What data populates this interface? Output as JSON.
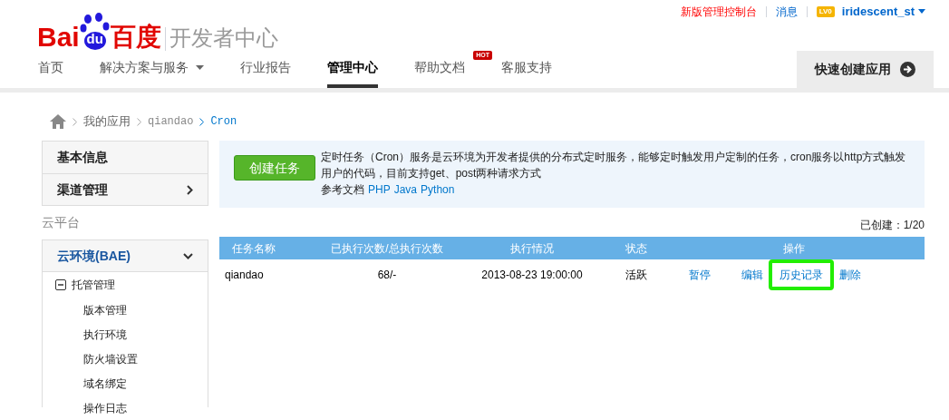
{
  "logo": {
    "parts": [
      "Bai",
      "du",
      "百度"
    ],
    "subtitle": "开发者中心"
  },
  "top_links": [
    {
      "kind": "red",
      "label": "新版管理控制台"
    },
    {
      "kind": "link",
      "label": "消息"
    },
    {
      "kind": "level",
      "label": "LV0"
    },
    {
      "kind": "user",
      "label": "iridescent_st"
    }
  ],
  "nav": {
    "items": [
      {
        "label": "首页",
        "selected": false
      },
      {
        "label": "解决方案与服务",
        "selected": false,
        "dropdown": true
      },
      {
        "label": "行业报告",
        "selected": false
      },
      {
        "label": "管理中心",
        "selected": true
      },
      {
        "label": "帮助文档",
        "selected": false,
        "badge": "HOT"
      },
      {
        "label": "客服支持",
        "selected": false
      }
    ],
    "action": "快速创建应用"
  },
  "breadcrumb": [
    {
      "label": "我的应用",
      "kind": "plain"
    },
    {
      "label": "qiandao",
      "kind": "mono"
    },
    {
      "label": "Cron",
      "kind": "current"
    }
  ],
  "sidebar": {
    "items": [
      {
        "label": "基本信息",
        "has_arrow": false
      },
      {
        "label": "渠道管理",
        "has_arrow": true
      }
    ],
    "section": "云平台",
    "group": {
      "label": "云环境(BAE)",
      "expanded": true,
      "children": [
        {
          "label": "托管管理",
          "expanded": true,
          "children": [
            {
              "label": "版本管理"
            },
            {
              "label": "执行环境"
            },
            {
              "label": "防火墙设置"
            },
            {
              "label": "域名绑定"
            },
            {
              "label": "操作日志"
            }
          ]
        }
      ]
    }
  },
  "intro": {
    "button": "创建任务",
    "text": "定时任务（Cron）服务是云环境为开发者提供的分布式定时服务，能够定时触发用户定制的任务，cron服务以http方式触发用户的代码，目前支持get、post两种请求方式",
    "docs_label": "参考文档",
    "docs": [
      "PHP",
      "Java",
      "Python"
    ]
  },
  "count": "已创建：1/20",
  "table": {
    "columns": [
      "任务名称",
      "已执行次数/总执行次数",
      "执行情况",
      "状态",
      "操作"
    ],
    "rows": [
      {
        "name": "qiandao",
        "runs": "68/-",
        "time": "2013-08-23 19:00:00",
        "status": "活跃",
        "actions": [
          {
            "label": "暂停",
            "highlighted": false
          },
          {
            "label": "编辑",
            "highlighted": false
          },
          {
            "label": "历史记录",
            "highlighted": true
          },
          {
            "label": "删除",
            "highlighted": false
          }
        ]
      }
    ]
  }
}
